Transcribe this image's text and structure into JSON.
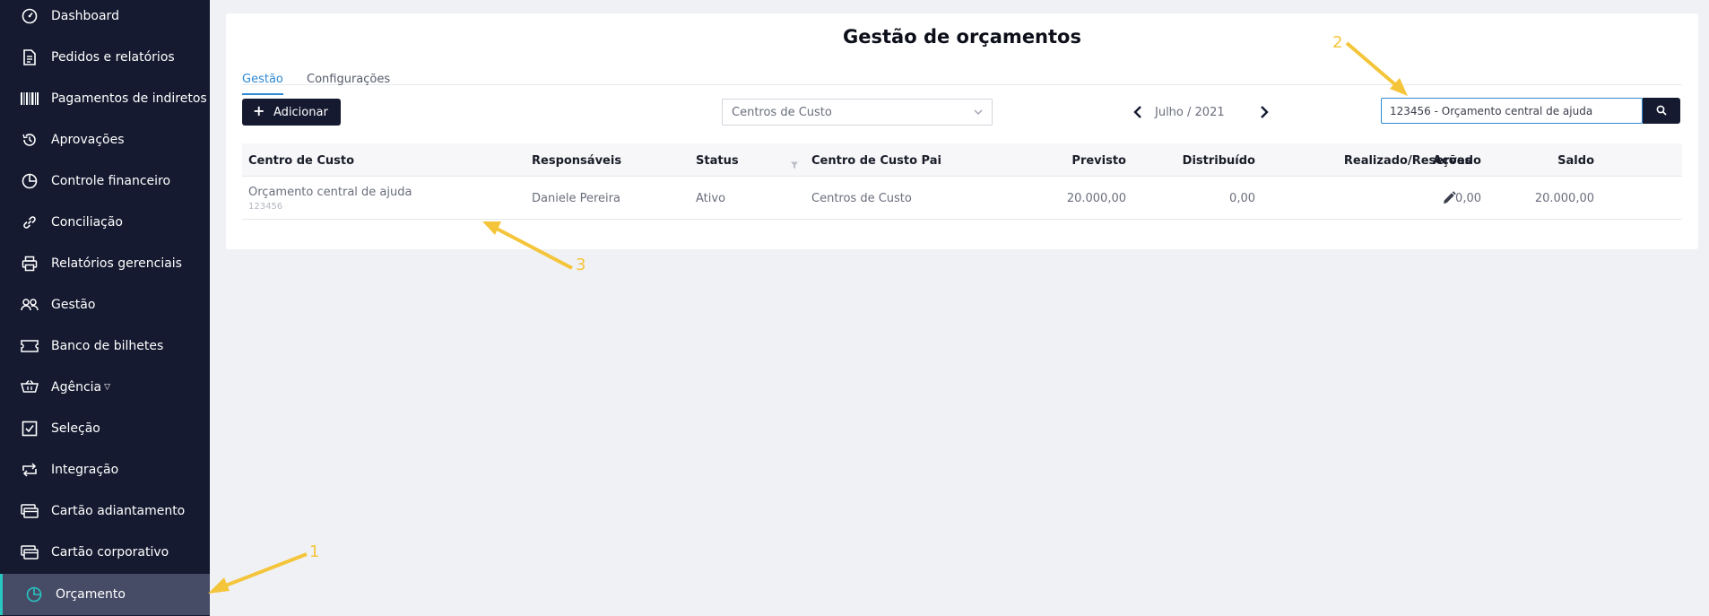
{
  "sidebar": {
    "items": [
      {
        "label": "Dashboard",
        "icon": "dashboard-icon"
      },
      {
        "label": "Pedidos e relatórios",
        "icon": "document-icon"
      },
      {
        "label": "Pagamentos de indiretos",
        "icon": "barcode-icon"
      },
      {
        "label": "Aprovações",
        "icon": "history-icon"
      },
      {
        "label": "Controle financeiro",
        "icon": "pie-chart-icon"
      },
      {
        "label": "Conciliação",
        "icon": "link-icon"
      },
      {
        "label": "Relatórios gerenciais",
        "icon": "printer-icon"
      },
      {
        "label": "Gestão",
        "icon": "users-icon"
      },
      {
        "label": "Banco de bilhetes",
        "icon": "ticket-icon"
      },
      {
        "label": "Agência",
        "icon": "basket-icon"
      },
      {
        "label": "Seleção",
        "icon": "checkbox-icon"
      },
      {
        "label": "Integração",
        "icon": "loop-icon"
      },
      {
        "label": "Cartão adiantamento",
        "icon": "cards-icon"
      },
      {
        "label": "Cartão corporativo",
        "icon": "cards-icon"
      },
      {
        "label": "Orçamento",
        "icon": "pie-chart-icon",
        "active": true
      }
    ]
  },
  "page": {
    "title": "Gestão de orçamentos",
    "tabs": [
      {
        "label": "Gestão",
        "active": true
      },
      {
        "label": "Configurações"
      }
    ]
  },
  "toolbar": {
    "add_label": "Adicionar",
    "select_value": "Centros de Custo",
    "month_label": "Julho / 2021",
    "search_value": "123456 - Orçamento central de ajuda"
  },
  "table": {
    "headers": {
      "centro": "Centro de Custo",
      "responsaveis": "Responsáveis",
      "status": "Status",
      "pai": "Centro de Custo Pai",
      "previsto": "Previsto",
      "distribuido": "Distribuído",
      "realizado": "Realizado/Reservado",
      "saldo": "Saldo",
      "acoes": "Ações"
    },
    "rows": [
      {
        "centro": "Orçamento central de ajuda",
        "codigo": "123456",
        "responsaveis": "Daniele Pereira",
        "status": "Ativo",
        "pai": "Centros de Custo",
        "previsto": "20.000,00",
        "distribuido": "0,00",
        "realizado": "0,00",
        "saldo": "20.000,00"
      }
    ]
  },
  "annotations": {
    "marker_1": "1",
    "marker_2": "2",
    "marker_3": "3",
    "color": "#f4c53a"
  },
  "colors": {
    "sidebar_bg": "#151a30",
    "sidebar_active_bg": "#464b66",
    "active_border": "#28c7c2",
    "accent": "#2f8ad4"
  }
}
